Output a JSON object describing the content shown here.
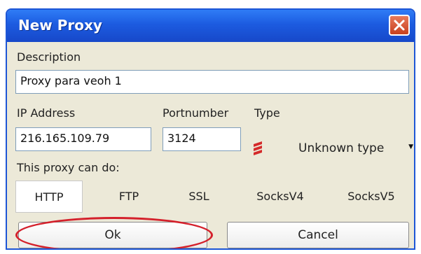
{
  "dialog": {
    "title": "New Proxy"
  },
  "fields": {
    "description_label": "Description",
    "description_value": "Proxy para veoh 1",
    "ip_label": "IP Address",
    "ip_value": "216.165.109.79",
    "port_label": "Portnumber",
    "port_value": "3124",
    "type_label": "Type",
    "type_value": "Unknown type"
  },
  "capabilities": {
    "label": "This proxy can do:",
    "options": [
      "HTTP",
      "FTP",
      "SSL",
      "SocksV4",
      "SocksV5"
    ],
    "selected": "HTTP"
  },
  "buttons": {
    "ok": "Ok",
    "cancel": "Cancel"
  },
  "colors": {
    "title_bar": "#1c5be0",
    "close_button": "#d3522f",
    "annotation": "#d4202b",
    "type_icon": "#d42a2a"
  }
}
